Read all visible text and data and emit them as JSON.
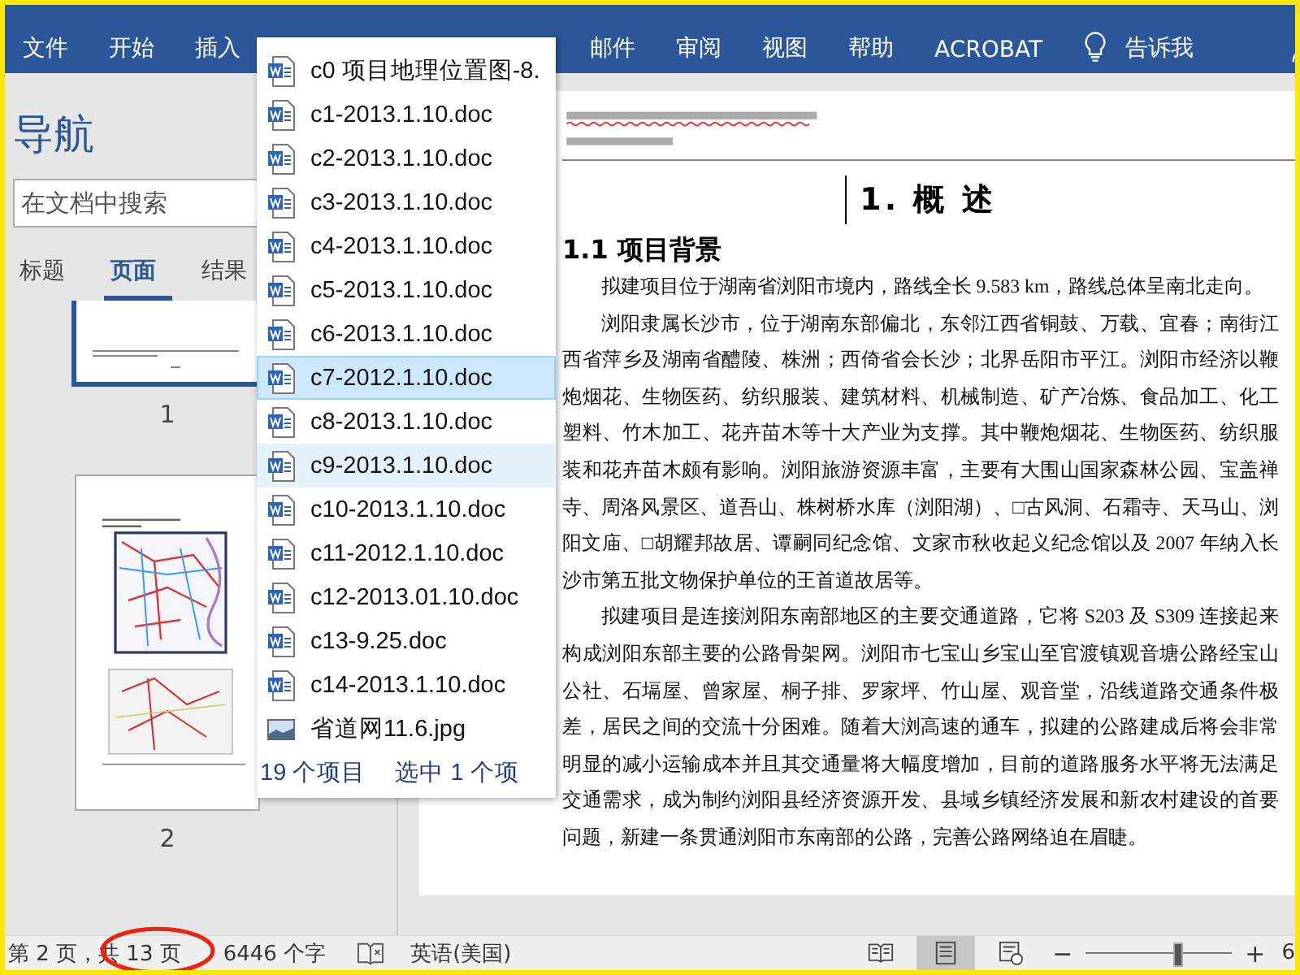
{
  "ribbon": {
    "tabs": [
      {
        "label": "文件"
      },
      {
        "label": "开始"
      },
      {
        "label": "插入"
      },
      {
        "label": "邮件"
      },
      {
        "label": "审阅"
      },
      {
        "label": "视图"
      },
      {
        "label": "帮助"
      },
      {
        "label": "ACROBAT"
      }
    ],
    "tell_me": "告诉我"
  },
  "navigation": {
    "title": "导航",
    "search": {
      "placeholder": "在文档中搜索"
    },
    "tabs": [
      {
        "label": "标题",
        "selected": false
      },
      {
        "label": "页面",
        "selected": true
      },
      {
        "label": "结果",
        "selected": false
      }
    ],
    "pages": [
      {
        "label": "1",
        "selected": true
      },
      {
        "label": "2",
        "selected": false
      }
    ]
  },
  "file_popup": {
    "items": [
      {
        "name": "c0 项目地理位置图-8.",
        "kind": "word",
        "selected": false,
        "hovered": false
      },
      {
        "name": "c1-2013.1.10.doc",
        "kind": "word",
        "selected": false,
        "hovered": false
      },
      {
        "name": "c2-2013.1.10.doc",
        "kind": "word",
        "selected": false,
        "hovered": false
      },
      {
        "name": "c3-2013.1.10.doc",
        "kind": "word",
        "selected": false,
        "hovered": false
      },
      {
        "name": "c4-2013.1.10.doc",
        "kind": "word",
        "selected": false,
        "hovered": false
      },
      {
        "name": "c5-2013.1.10.doc",
        "kind": "word",
        "selected": false,
        "hovered": false
      },
      {
        "name": "c6-2013.1.10.doc",
        "kind": "word",
        "selected": false,
        "hovered": false
      },
      {
        "name": "c7-2012.1.10.doc",
        "kind": "word",
        "selected": true,
        "hovered": false
      },
      {
        "name": "c8-2013.1.10.doc",
        "kind": "word",
        "selected": false,
        "hovered": false
      },
      {
        "name": "c9-2013.1.10.doc",
        "kind": "word",
        "selected": false,
        "hovered": true
      },
      {
        "name": "c10-2013.1.10.doc",
        "kind": "word",
        "selected": false,
        "hovered": false
      },
      {
        "name": "c11-2012.1.10.doc",
        "kind": "word",
        "selected": false,
        "hovered": false
      },
      {
        "name": "c12-2013.01.10.doc",
        "kind": "word",
        "selected": false,
        "hovered": false
      },
      {
        "name": "c13-9.25.doc",
        "kind": "word",
        "selected": false,
        "hovered": false
      },
      {
        "name": "c14-2013.1.10.doc",
        "kind": "word",
        "selected": false,
        "hovered": false
      },
      {
        "name": "省道网11.6.jpg",
        "kind": "image",
        "selected": false,
        "hovered": false
      }
    ],
    "status": [
      "19 个项目",
      "选中 1 个项"
    ]
  },
  "document": {
    "heading": "1. 概 述",
    "subheading": "1.1 项目背景",
    "paragraphs": [
      "拟建项目位于湖南省浏阳市境内，路线全长 9.583 km，路线总体呈南北走向。",
      "浏阳隶属长沙市，位于湖南东部偏北，东邻江西省铜鼓、万载、宜春；南街江西省萍乡及湖南省醴陵、株洲；西倚省会长沙；北界岳阳市平江。浏阳市经济以鞭炮烟花、生物医药、纺织服装、建筑材料、机械制造、矿产冶炼、食品加工、化工塑料、竹木加工、花卉苗木等十大产业为支撑。其中鞭炮烟花、生物医药、纺织服装和花卉苗木颇有影响。浏阳旅游资源丰富，主要有大围山国家森林公园、宝盖禅寺、周洛风景区、道吾山、株树桥水库（浏阳湖）、□古风洞、石霜寺、天马山、浏阳文庙、□胡耀邦故居、谭嗣同纪念馆、文家市秋收起义纪念馆以及 2007 年纳入长沙市第五批文物保护单位的王首道故居等。",
      "拟建项目是连接浏阳东南部地区的主要交通道路，它将 S203 及 S309 连接起来构成浏阳东部主要的公路骨架网。浏阳市七宝山乡宝山至官渡镇观音塘公路经宝山公社、石塥屋、曾家屋、桐子排、罗家坪、竹山屋、观音堂，沿线道路交通条件极差，居民之间的交流十分困难。随着大浏高速的通车，拟建的公路建成后将会非常明显的减小运输成本并且其交通量将大幅度增加，目前的道路服务水平将无法满足交通需求，成为制约浏阳县经济资源开发、县域乡镇经济发展和新农村建设的首要问题，新建一条贯通浏阳市东南部的公路，完善公路网络迫在眉睫。"
    ]
  },
  "status_bar": {
    "page": "第 2 页，共 13 页",
    "words": "6446 个字",
    "language": "英语(美国)",
    "views": [
      {
        "kind": "read",
        "selected": false
      },
      {
        "kind": "print",
        "selected": true
      },
      {
        "kind": "web",
        "selected": false
      }
    ],
    "zoom": {
      "minus": "−",
      "plus": "+",
      "level": 0.62,
      "reading": "6"
    }
  }
}
